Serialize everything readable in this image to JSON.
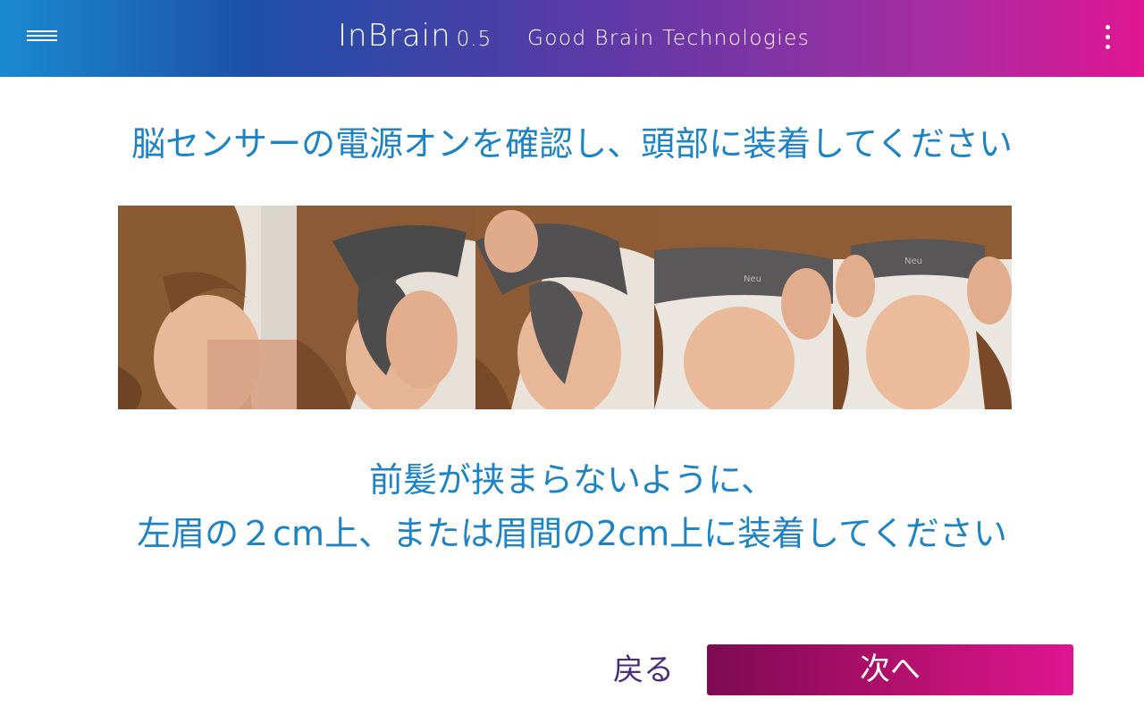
{
  "header": {
    "menu_icon": "hamburger-menu-icon",
    "app_name": "InBrain",
    "app_version": "0.5",
    "company": "Good Brain Technologies",
    "more_icon": "more-vertical-icon",
    "gradient_colors": [
      "#1a8ad0",
      "#1d4fa8",
      "#5b3aa6",
      "#a12ea3",
      "#e01592"
    ]
  },
  "main": {
    "instruction": "脳センサーの電源オンを確認し、頭部に装着してください",
    "note_line1": "前髪が挟まらないように、",
    "note_line2": "左眉の２cm上、または眉間の2cm上に装着してください",
    "text_color": "#1d83c4"
  },
  "photos": {
    "count": 5,
    "band_text": "Neu"
  },
  "footer": {
    "back_label": "戻る",
    "next_label": "次へ",
    "back_color": "#4b2a7a",
    "next_colors": [
      "#7d0a52",
      "#e01592"
    ]
  }
}
